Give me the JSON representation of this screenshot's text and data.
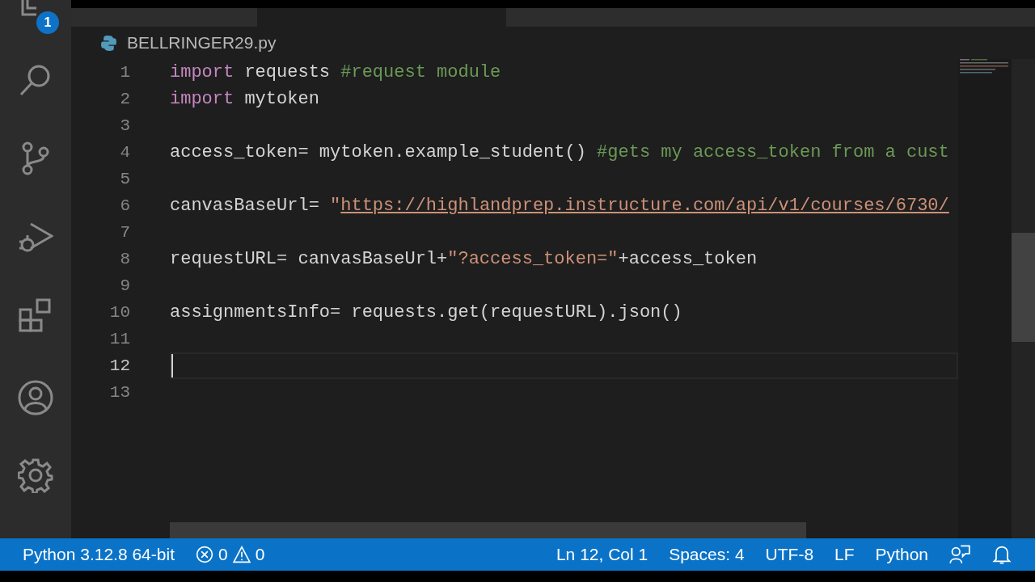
{
  "activity_bar": {
    "items": [
      {
        "kind": "files",
        "badge": "1"
      },
      {
        "kind": "search"
      },
      {
        "kind": "source-control"
      },
      {
        "kind": "run"
      },
      {
        "kind": "extensions"
      }
    ],
    "bottom_items": [
      {
        "kind": "account"
      },
      {
        "kind": "settings"
      }
    ]
  },
  "breadcrumb": {
    "file": "BELLRINGER29.py"
  },
  "editor": {
    "lines": [
      {
        "number": "1",
        "active": false,
        "tokens": [
          {
            "kind": "keyword",
            "text": "import"
          },
          {
            "kind": "plain",
            "text": " requests "
          },
          {
            "kind": "comment",
            "text": "#request module"
          }
        ]
      },
      {
        "number": "2",
        "active": false,
        "tokens": [
          {
            "kind": "keyword",
            "text": "import"
          },
          {
            "kind": "plain",
            "text": " mytoken"
          }
        ]
      },
      {
        "number": "3",
        "active": false
      },
      {
        "number": "4",
        "active": false,
        "tokens": [
          {
            "kind": "plain",
            "text": "access_token= mytoken.example_student() "
          },
          {
            "kind": "comment",
            "text": "#gets my access_token from a cust"
          }
        ]
      },
      {
        "number": "5",
        "active": false
      },
      {
        "number": "6",
        "active": false,
        "tokens": [
          {
            "kind": "plain",
            "text": "canvasBaseUrl= "
          },
          {
            "kind": "string",
            "text": "\""
          },
          {
            "kind": "link",
            "text": "https://highlandprep.instructure.com/api/v1/courses/6730/"
          }
        ]
      },
      {
        "number": "7",
        "active": false
      },
      {
        "number": "8",
        "active": false,
        "tokens": [
          {
            "kind": "plain",
            "text": "requestURL= canvasBaseUrl+"
          },
          {
            "kind": "string",
            "text": "\"?access_token=\""
          },
          {
            "kind": "plain",
            "text": "+access_token"
          }
        ]
      },
      {
        "number": "9",
        "active": false
      },
      {
        "number": "10",
        "active": false,
        "tokens": [
          {
            "kind": "plain",
            "text": "assignmentsInfo= requests.get(requestURL).json()"
          }
        ]
      },
      {
        "number": "11",
        "active": false
      },
      {
        "number": "12",
        "active": true
      },
      {
        "number": "13",
        "active": false
      }
    ]
  },
  "status_bar": {
    "left": [
      {
        "kind": "text",
        "text": "Python 3.12.8 64-bit"
      },
      {
        "kind": "problems",
        "errors": "0",
        "warnings": "0"
      }
    ],
    "right": [
      {
        "kind": "text",
        "text": "Ln 12, Col 1"
      },
      {
        "kind": "text",
        "text": "Spaces: 4"
      },
      {
        "kind": "text",
        "text": "UTF-8"
      },
      {
        "kind": "text",
        "text": "LF"
      },
      {
        "kind": "text",
        "text": "Python"
      },
      {
        "kind": "feedback"
      },
      {
        "kind": "bell"
      }
    ]
  }
}
